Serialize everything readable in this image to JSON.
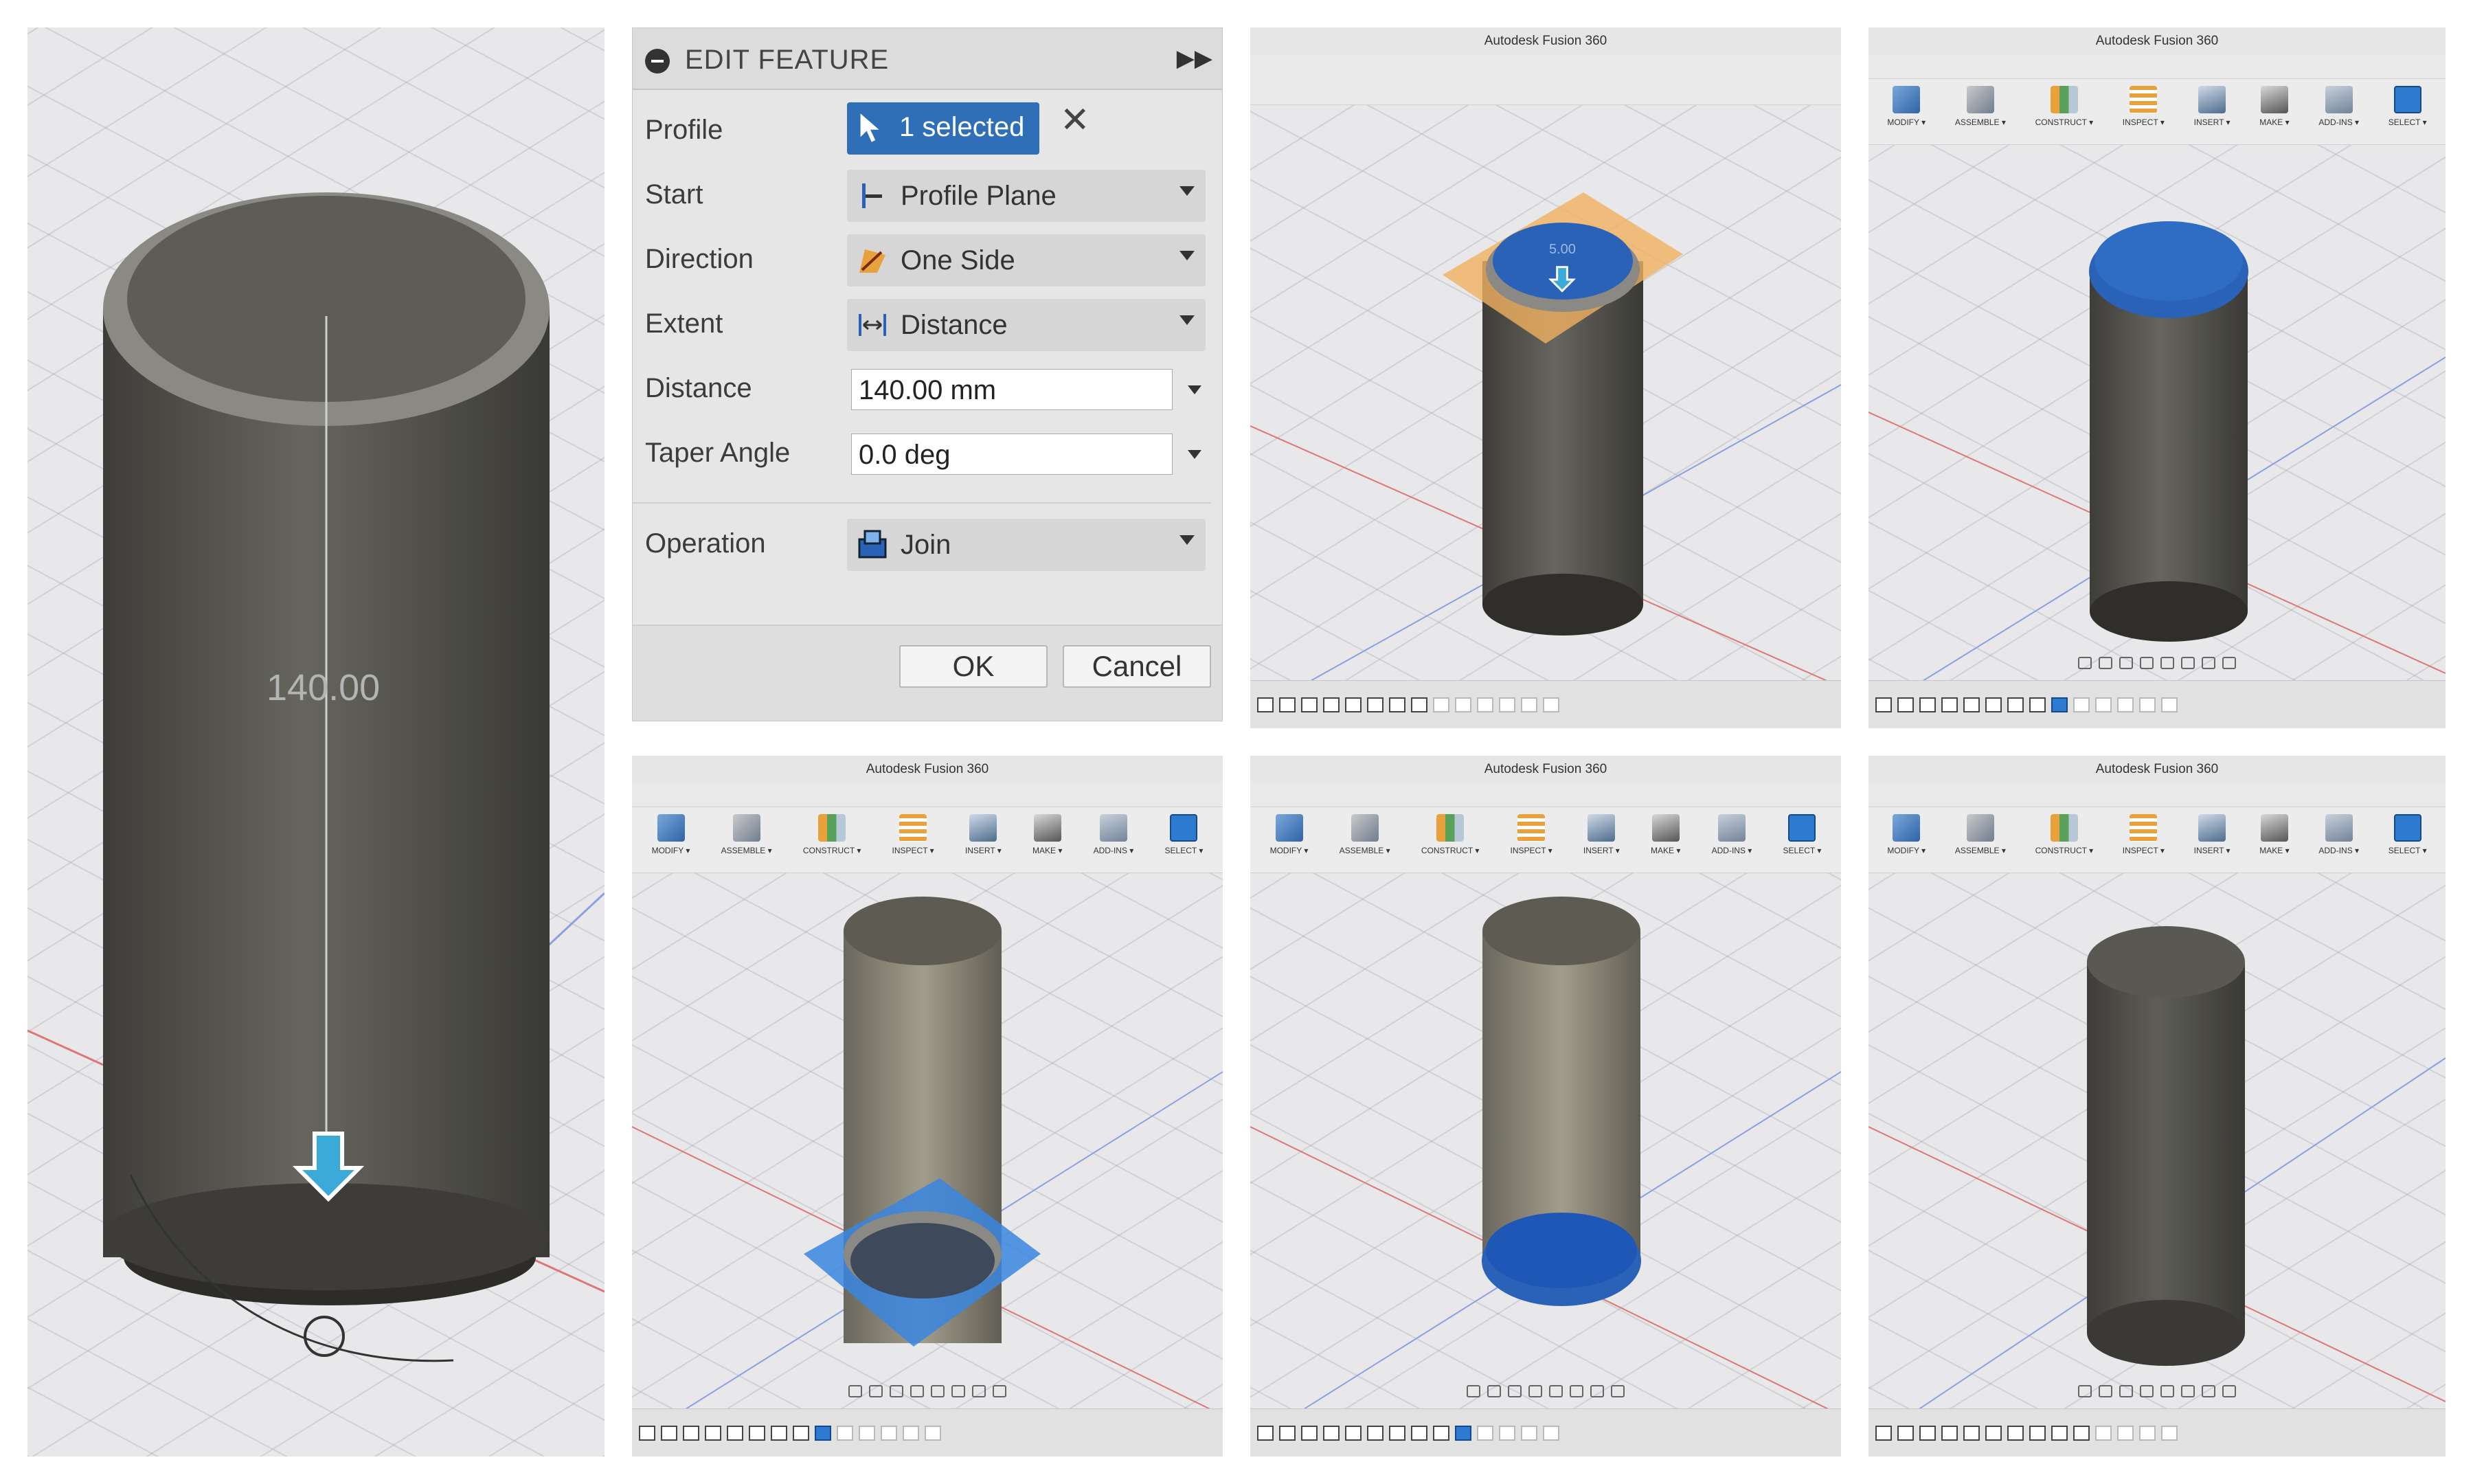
{
  "app": {
    "window_title": "Autodesk Fusion 360"
  },
  "ribbon": {
    "items": [
      {
        "label": "MODIFY ▾",
        "icon": "modify-icon"
      },
      {
        "label": "ASSEMBLE ▾",
        "icon": "assemble-icon"
      },
      {
        "label": "CONSTRUCT ▾",
        "icon": "construct-icon"
      },
      {
        "label": "INSPECT ▾",
        "icon": "inspect-icon"
      },
      {
        "label": "INSERT ▾",
        "icon": "insert-icon"
      },
      {
        "label": "MAKE ▾",
        "icon": "make-icon"
      },
      {
        "label": "ADD-INS ▾",
        "icon": "add-ins-icon"
      },
      {
        "label": "SELECT ▾",
        "icon": "select-icon"
      }
    ]
  },
  "dialog": {
    "title": "EDIT FEATURE",
    "profile": {
      "label": "Profile",
      "value": "1 selected"
    },
    "start": {
      "label": "Start",
      "value": "Profile Plane"
    },
    "direction": {
      "label": "Direction",
      "value": "One Side"
    },
    "extent": {
      "label": "Extent",
      "value": "Distance"
    },
    "distance": {
      "label": "Distance",
      "value": "140.00 mm"
    },
    "taper": {
      "label": "Taper Angle",
      "value": "0.0 deg"
    },
    "operation": {
      "label": "Operation",
      "value": "Join"
    },
    "ok": "OK",
    "cancel": "Cancel"
  },
  "viewport_main": {
    "dimension_label": "140.00"
  },
  "viewport_top": {
    "dimension_label": "5.00"
  },
  "colors": {
    "body": "#5e5d57",
    "selection_blue": "#2a62b8",
    "plane_orange": "#f0b060",
    "plane_blue": "#3a86e0",
    "manipulator": "#3aaad8"
  }
}
